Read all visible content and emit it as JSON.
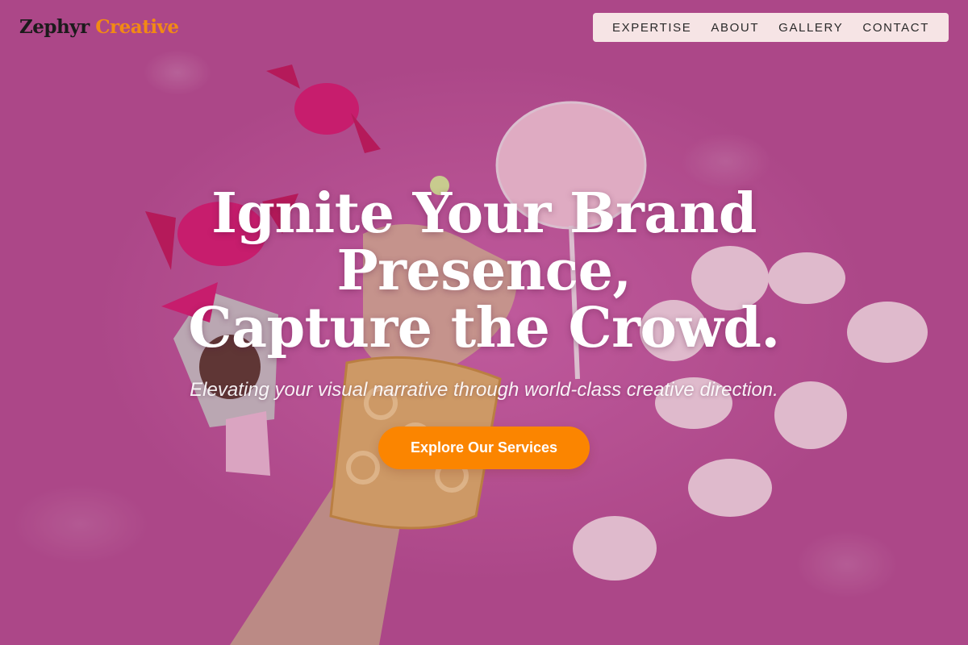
{
  "brand": {
    "name_part1": "Zephyr",
    "name_part2": "Creative"
  },
  "nav": {
    "items": [
      {
        "label": "EXPERTISE"
      },
      {
        "label": "ABOUT"
      },
      {
        "label": "GALLERY"
      },
      {
        "label": "CONTACT"
      }
    ]
  },
  "hero": {
    "headline_lines": [
      "Ignite Your Brand",
      "Presence,",
      "Capture the Crowd."
    ],
    "subtitle": "Elevating your visual narrative through world-class creative direction.",
    "cta_label": "Explore Our Services"
  },
  "colors": {
    "accent": "#fb8500",
    "logo_dark": "#1b1b1b",
    "logo_accent": "#f28a14",
    "nav_bg": "#fcf0ec",
    "background_pink": "#cf66ac"
  }
}
